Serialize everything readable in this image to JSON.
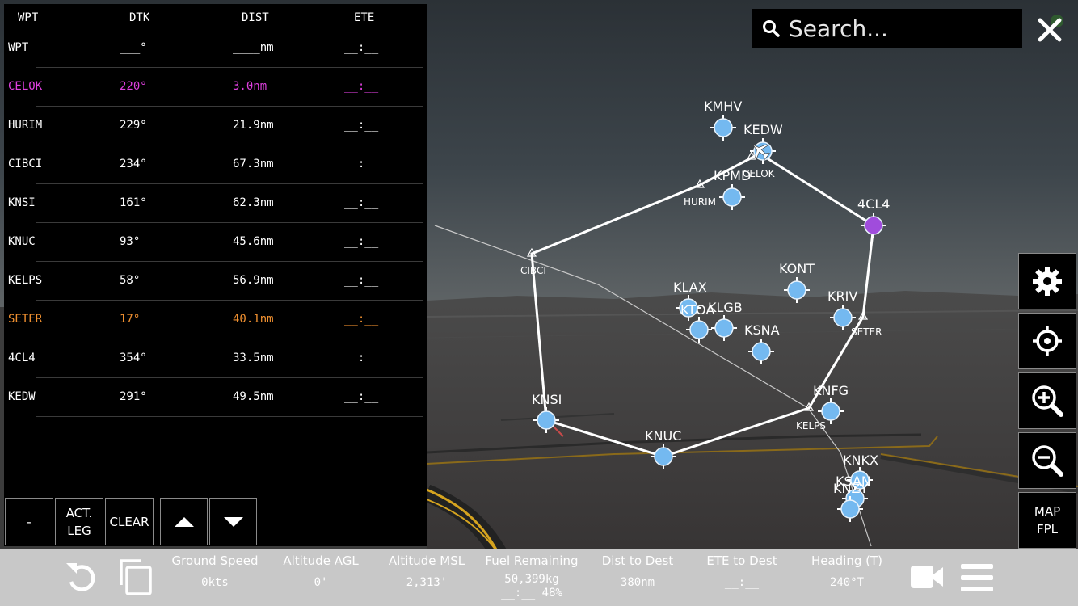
{
  "flight_plan": {
    "headers": {
      "wpt": "WPT",
      "dtk": "DTK",
      "dist": "DIST",
      "ete": "ETE"
    },
    "rows": [
      {
        "wpt": "WPT",
        "dtk": "___°",
        "dist": "____nm",
        "ete": "__:__",
        "state": "placeholder"
      },
      {
        "wpt": "CELOK",
        "dtk": "220°",
        "dist": "3.0nm",
        "ete": "__:__",
        "state": "active"
      },
      {
        "wpt": "HURIM",
        "dtk": "229°",
        "dist": "21.9nm",
        "ete": "__:__",
        "state": "normal"
      },
      {
        "wpt": "CIBCI",
        "dtk": "234°",
        "dist": "67.3nm",
        "ete": "__:__",
        "state": "normal"
      },
      {
        "wpt": "KNSI",
        "dtk": "161°",
        "dist": "62.3nm",
        "ete": "__:__",
        "state": "normal"
      },
      {
        "wpt": "KNUC",
        "dtk": "93°",
        "dist": "45.6nm",
        "ete": "__:__",
        "state": "normal"
      },
      {
        "wpt": "KELPS",
        "dtk": "58°",
        "dist": "56.9nm",
        "ete": "__:__",
        "state": "normal"
      },
      {
        "wpt": "SETER",
        "dtk": "17°",
        "dist": "40.1nm",
        "ete": "__:__",
        "state": "next"
      },
      {
        "wpt": "4CL4",
        "dtk": "354°",
        "dist": "33.5nm",
        "ete": "__:__",
        "state": "normal"
      },
      {
        "wpt": "KEDW",
        "dtk": "291°",
        "dist": "49.5nm",
        "ete": "__:__",
        "state": "normal"
      }
    ],
    "buttons": {
      "minus": "-",
      "act_leg_1": "ACT.",
      "act_leg_2": "LEG",
      "clear": "CLEAR"
    }
  },
  "search": {
    "placeholder": "Search..."
  },
  "map_fpl": {
    "line1": "MAP",
    "line2": "FPL"
  },
  "map": {
    "airports": [
      {
        "id": "KMHV",
        "label": "KMHV"
      },
      {
        "id": "KEDW",
        "label": "KEDW"
      },
      {
        "id": "KPMD",
        "label": "KPMD"
      },
      {
        "id": "4CL4",
        "label": "4CL4"
      },
      {
        "id": "KONT",
        "label": "KONT"
      },
      {
        "id": "KLAX",
        "label": "KLAX"
      },
      {
        "id": "KTOA",
        "label": "KTOA"
      },
      {
        "id": "KLGB",
        "label": "KLGB"
      },
      {
        "id": "KSNA",
        "label": "KSNA"
      },
      {
        "id": "KRIV",
        "label": "KRIV"
      },
      {
        "id": "KNFG",
        "label": "KNFG"
      },
      {
        "id": "KNSI",
        "label": "KNSI"
      },
      {
        "id": "KNUC",
        "label": "KNUC"
      },
      {
        "id": "KNKX",
        "label": "KNKX"
      },
      {
        "id": "KSAN",
        "label": "KSAN"
      },
      {
        "id": "KNZY",
        "label": "KNZY"
      }
    ],
    "fixes": [
      {
        "id": "CELOK",
        "label": "CELOK"
      },
      {
        "id": "HURIM",
        "label": "HURIM"
      },
      {
        "id": "CIBCI",
        "label": "CIBCI"
      },
      {
        "id": "SETER",
        "label": "SETER"
      },
      {
        "id": "KELPS",
        "label": "KELPS"
      }
    ],
    "colors": {
      "airport": "#74b9f0",
      "active_waypoint": "#a04cdc",
      "route": "#ffffff"
    }
  },
  "status_bar": {
    "ground_speed": {
      "label": "Ground Speed",
      "value": "0kts"
    },
    "altitude_agl": {
      "label": "Altitude AGL",
      "value": "0'"
    },
    "altitude_msl": {
      "label": "Altitude MSL",
      "value": "2,313'"
    },
    "fuel_remaining": {
      "label": "Fuel Remaining",
      "value": "50,399kg",
      "value2": "__:__ 48%"
    },
    "dist_to_dest": {
      "label": "Dist to Dest",
      "value": "380nm"
    },
    "ete_to_dest": {
      "label": "ETE to Dest",
      "value": "__:__"
    },
    "heading": {
      "label": "Heading (T)",
      "value": "240°T"
    }
  },
  "icons": {
    "search": "search-icon",
    "close": "close-icon",
    "settings": "gear-icon",
    "center": "crosshair-icon",
    "zoom_in": "zoom-in-icon",
    "zoom_out": "zoom-out-icon",
    "up": "arrow-up-icon",
    "down": "arrow-down-icon",
    "reset": "reset-icon",
    "copy": "copy-icon",
    "camera": "camera-icon",
    "menu": "menu-icon"
  }
}
